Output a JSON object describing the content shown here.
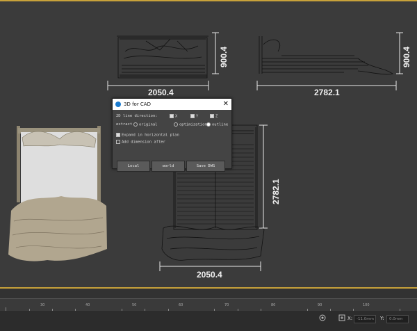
{
  "viewport": {
    "dimensions": {
      "front_width": "2050.4",
      "front_height": "900.4",
      "side_width": "2782.1",
      "side_height": "900.4",
      "top_width": "2050.4",
      "top_height": "2782.1"
    }
  },
  "dialog": {
    "title": "3D for CAD",
    "close": "✕",
    "line_direction_label": "2D line direction:",
    "dir_x": "X",
    "dir_y": "Y",
    "dir_z": "Z",
    "extract_label": "extract",
    "opt_original": "original",
    "opt_optimization": "optimization",
    "opt_outline": "outline",
    "expand_label": "Expand in horizontal plan",
    "add_dimension_label": "Add dimension after",
    "btn_local": "Local",
    "btn_world": "world",
    "btn_save": "Save DWG"
  },
  "ruler": {
    "labels": [
      "30",
      "40",
      "50",
      "60",
      "70",
      "80",
      "90",
      "100"
    ]
  },
  "statusbar": {
    "x_label": "X:",
    "x_value": "-11.0mm",
    "y_label": "Y:",
    "y_value": "0.0mm"
  }
}
